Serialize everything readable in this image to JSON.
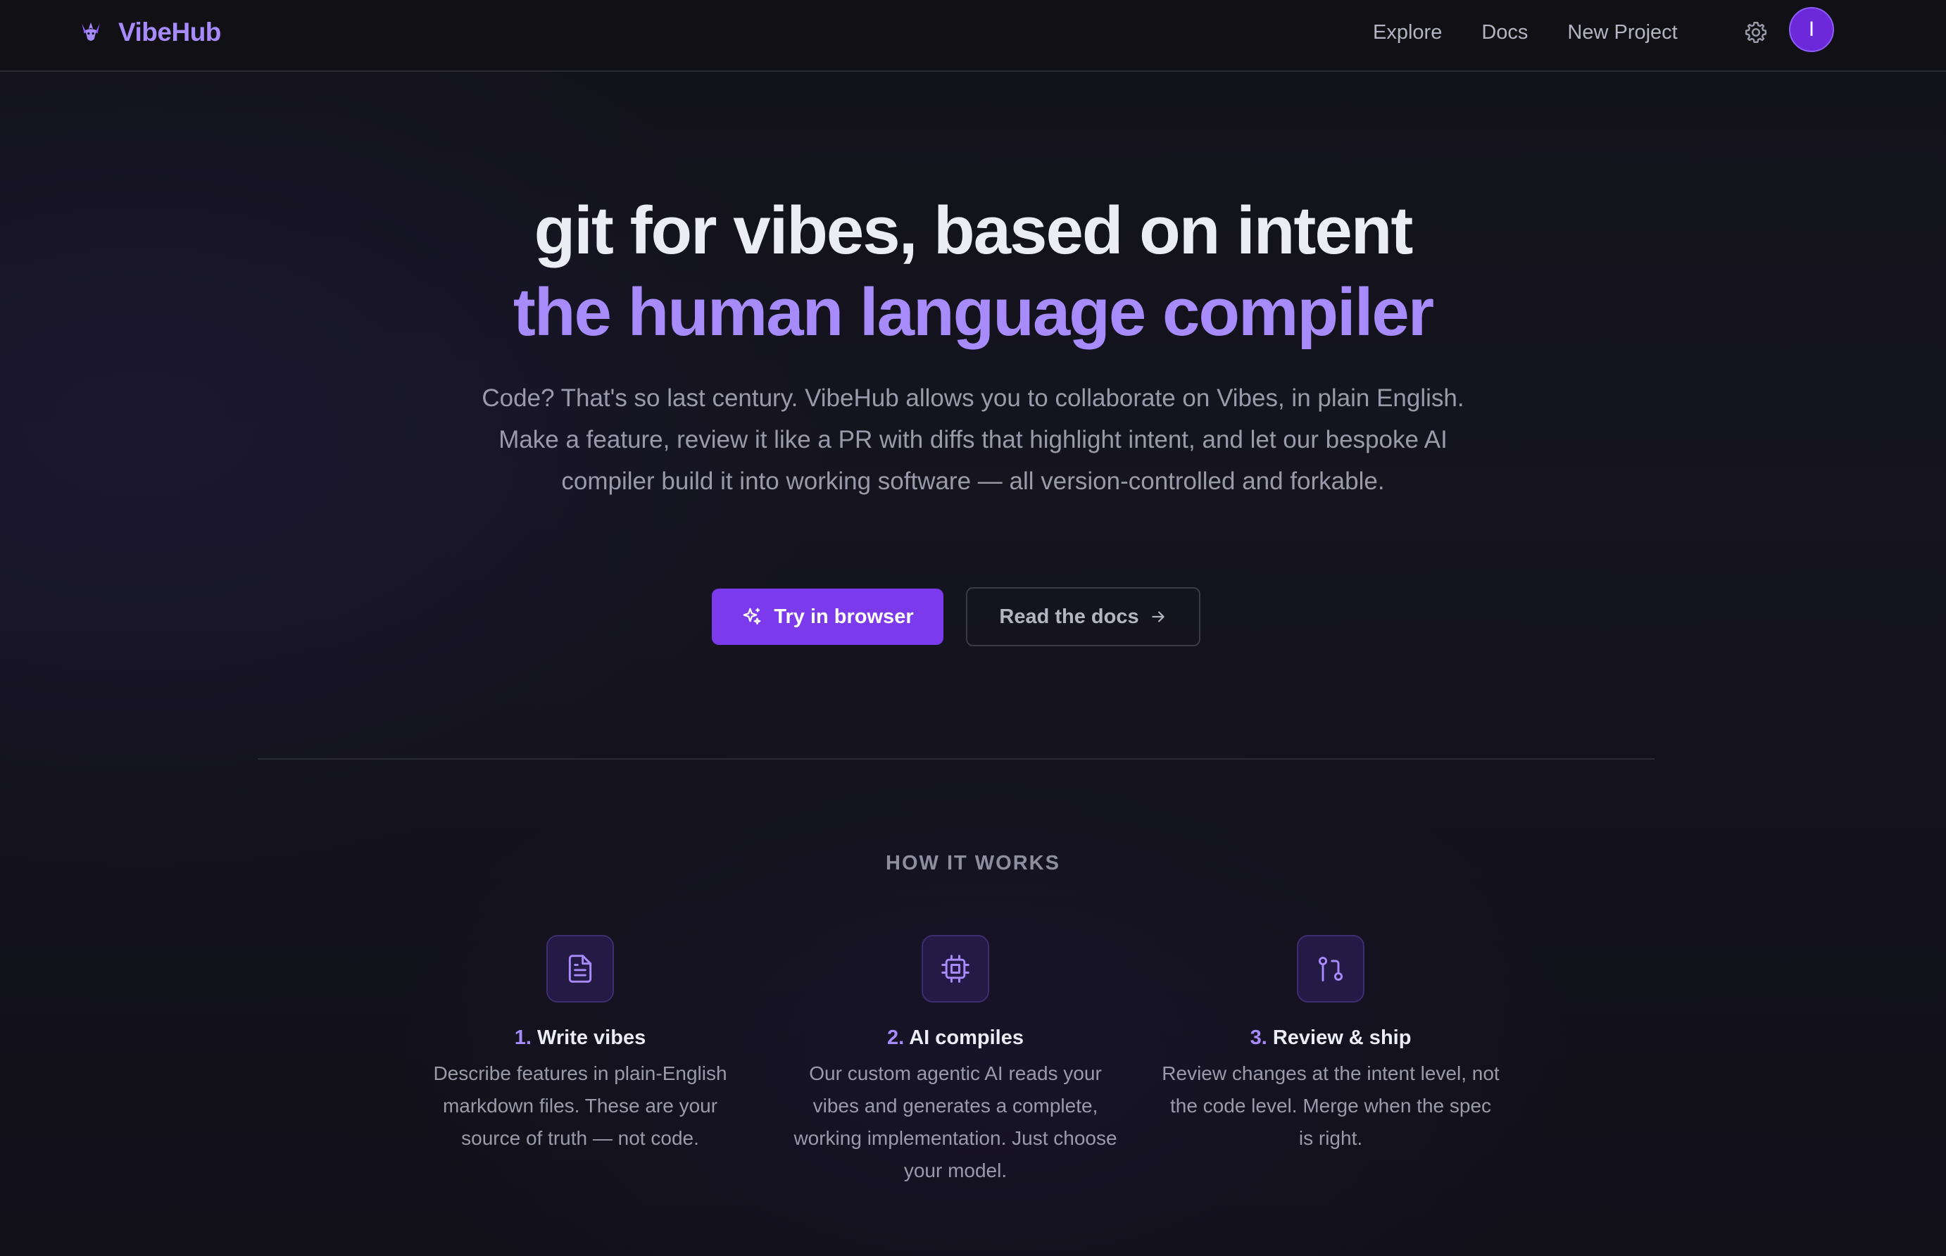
{
  "header": {
    "brand": "VibeHub",
    "nav": {
      "explore": "Explore",
      "docs": "Docs",
      "new_project": "New Project"
    },
    "avatar_initial": "I"
  },
  "hero": {
    "title": "git for vibes, based on intent",
    "subtitle": "the human language compiler",
    "description": "Code? That's so last century. VibeHub allows you to collaborate on Vibes, in plain English. Make a feature, review it like a PR with diffs that highlight intent, and let our bespoke AI compiler build it into working software — all version-controlled and forkable.",
    "primary_button": "Try in browser",
    "secondary_button": "Read the docs"
  },
  "how_it_works": {
    "label": "HOW IT WORKS",
    "steps": [
      {
        "number": "1.",
        "title": "Write vibes",
        "description": "Describe features in plain-English markdown files. These are your source of truth — not code.",
        "icon": "file-text-icon"
      },
      {
        "number": "2.",
        "title": "AI compiles",
        "description": "Our custom agentic AI reads your vibes and generates a complete, working implementation. Just choose your model.",
        "icon": "cpu-icon"
      },
      {
        "number": "3.",
        "title": "Review & ship",
        "description": "Review changes at the intent level, not the code level. Merge when the spec is right.",
        "icon": "git-pull-request-icon"
      }
    ]
  },
  "colors": {
    "accent": "#a78bfa",
    "primary_button": "#7c3aed",
    "background": "#12121a",
    "avatar": "#6d28d9"
  }
}
